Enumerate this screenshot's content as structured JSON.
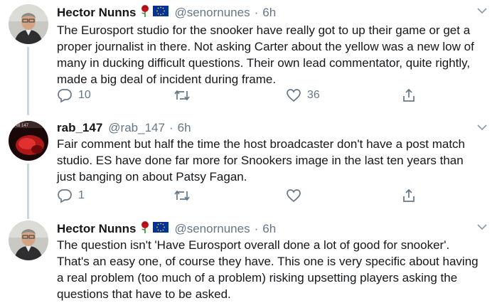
{
  "tweets": [
    {
      "name": "Hector Nunns",
      "handle": "@senornunes",
      "dot": "·",
      "time": "6h",
      "text": "The Eurosport studio for the snooker have really got to up their game or get a proper journalist in there. Not asking Carter about the yellow was a new low of many in ducking difficult questions. Their own lead commentator, quite rightly, made a big deal of incident during frame.",
      "replies": "10",
      "retweets": "",
      "likes": "36"
    },
    {
      "name": "rab_147",
      "handle": "@rab_147",
      "dot": "·",
      "time": "6h",
      "text": "Fair comment but half the time the host broadcaster don't have a post match studio. ES have done far more for Snookers image in the last ten years than just banging on about Patsy Fagan.",
      "replies": "1",
      "retweets": "",
      "likes": ""
    },
    {
      "name": "Hector Nunns",
      "handle": "@senornunes",
      "dot": "·",
      "time": "6h",
      "text": "The question isn't 'Have Eurosport overall done a lot of good for snooker'. That's an easy one, of course they have. This one is very specific about having a real problem (too much of a problem) risking upsetting players asking the questions that have to be asked."
    }
  ],
  "icons": {
    "rose": "rose-icon",
    "eu_flag": "eu-flag-icon",
    "reply": "reply-icon",
    "retweet": "retweet-icon",
    "like": "heart-icon",
    "share": "share-icon",
    "more": "chevron-down-icon"
  },
  "colors": {
    "secondary_text": "#657786",
    "thread_line": "#ccd6dd",
    "eu_blue": "#003399",
    "rose_red": "#c0141c"
  }
}
